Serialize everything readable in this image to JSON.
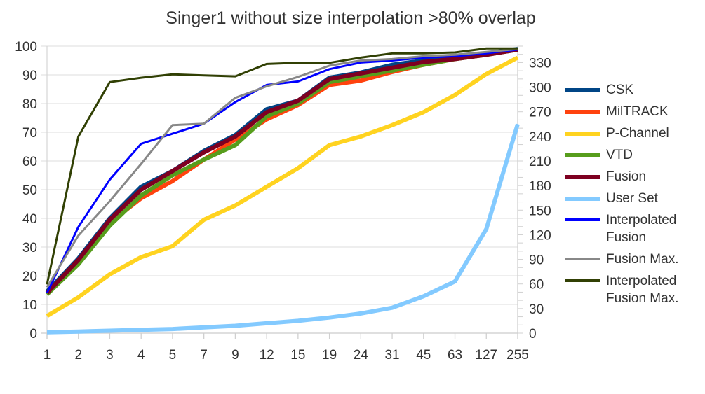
{
  "chart_data": {
    "type": "line",
    "title": "Singer1 without size interpolation >80% overlap",
    "xlabel": "",
    "ylabel": "",
    "y2label": "",
    "categories": [
      "1",
      "2",
      "3",
      "4",
      "5",
      "7",
      "9",
      "12",
      "15",
      "19",
      "24",
      "31",
      "45",
      "63",
      "127",
      "255"
    ],
    "ylim": [
      0,
      100
    ],
    "yticks": [
      0,
      10,
      20,
      30,
      40,
      50,
      60,
      70,
      80,
      90,
      100
    ],
    "y2lim": [
      0,
      350
    ],
    "y2ticks": [
      0,
      30,
      60,
      90,
      120,
      150,
      180,
      210,
      240,
      270,
      300,
      330
    ],
    "grid": true,
    "legend_position": "right",
    "series": [
      {
        "name": "CSK",
        "color": "#004586",
        "width": 6,
        "axis": "left",
        "values": [
          14.5,
          26,
          40,
          51,
          56.5,
          63.5,
          69,
          78,
          81,
          89,
          90.8,
          93.5,
          95,
          96,
          97.5,
          99
        ]
      },
      {
        "name": "MilTRACK",
        "color": "#ff420e",
        "width": 6,
        "axis": "left",
        "values": [
          14,
          25,
          38.5,
          47,
          53,
          60.5,
          67.5,
          74.5,
          79.5,
          86.5,
          88,
          91,
          93.5,
          95.5,
          97,
          98.8
        ]
      },
      {
        "name": "P-Channel",
        "color": "#ffd320",
        "width": 6,
        "axis": "left",
        "values": [
          6,
          12.5,
          20.5,
          26.5,
          30.3,
          39.5,
          44.5,
          51,
          57.5,
          65.5,
          68.5,
          72.5,
          77,
          83,
          90.3,
          96
        ]
      },
      {
        "name": "VTD",
        "color": "#579d1c",
        "width": 6,
        "axis": "left",
        "values": [
          13.5,
          24,
          37.5,
          48,
          55,
          60.5,
          65.5,
          75.5,
          80,
          87.5,
          89.5,
          91.5,
          93.5,
          95.5,
          97,
          98.8
        ]
      },
      {
        "name": "Fusion",
        "color": "#7e0021",
        "width": 6,
        "axis": "left",
        "values": [
          14,
          25.5,
          39.5,
          50,
          56.5,
          63,
          68.5,
          77,
          81,
          88.5,
          90.5,
          92.5,
          94.5,
          95.5,
          97,
          98.8
        ]
      },
      {
        "name": "User Set",
        "color": "#83caff",
        "width": 6,
        "axis": "right",
        "values": [
          1,
          2,
          3,
          4,
          5,
          7,
          9,
          12,
          15,
          19,
          24,
          31,
          45,
          63,
          127,
          255
        ]
      },
      {
        "name": "Interpolated Fusion",
        "color": "#0000ff",
        "width": 3,
        "axis": "left",
        "values": [
          14,
          37,
          53.5,
          66,
          69.5,
          73,
          80.5,
          86.5,
          87.7,
          92,
          94.3,
          95,
          96,
          96.5,
          97.5,
          98.8
        ]
      },
      {
        "name": "Fusion Max.",
        "color": "#888888",
        "width": 3,
        "axis": "left",
        "values": [
          16,
          34,
          46,
          59,
          72.5,
          73,
          82,
          86,
          89.3,
          93.2,
          95,
          95.5,
          96.5,
          97,
          98,
          99
        ]
      },
      {
        "name": "Interpolated Fusion Max.",
        "color": "#314004",
        "width": 3,
        "axis": "left",
        "values": [
          17,
          68.5,
          87.5,
          89,
          90.2,
          89.8,
          89.5,
          93.8,
          94.2,
          94.2,
          96,
          97.5,
          97.5,
          97.8,
          99.2,
          99.2
        ]
      }
    ]
  },
  "legend": {
    "items": [
      {
        "label": "CSK"
      },
      {
        "label": "MilTRACK"
      },
      {
        "label": "P-Channel"
      },
      {
        "label": "VTD"
      },
      {
        "label": "Fusion"
      },
      {
        "label": "User Set"
      },
      {
        "label": "Interpolated Fusion"
      },
      {
        "label": "Fusion Max."
      },
      {
        "label": "Interpolated Fusion Max."
      }
    ]
  }
}
